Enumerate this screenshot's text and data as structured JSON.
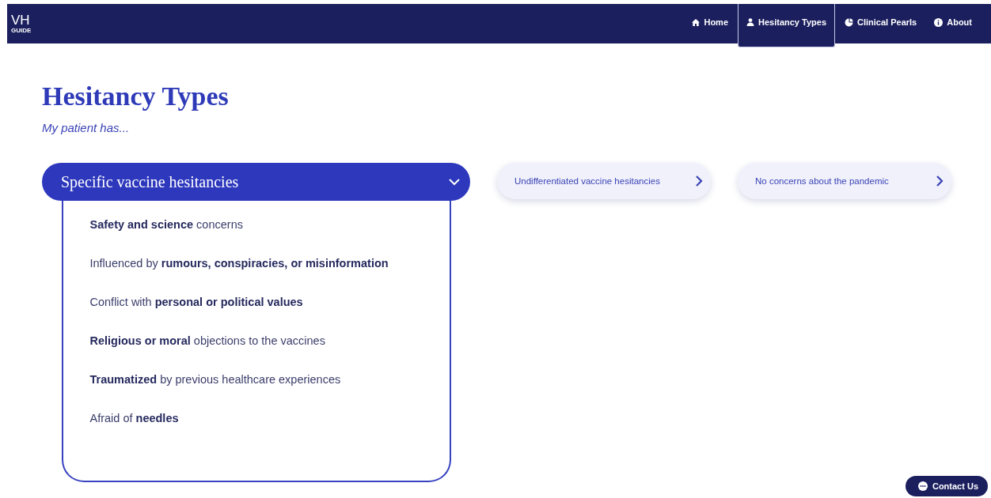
{
  "logo": {
    "title": "VH",
    "subtitle": "GUIDE"
  },
  "nav": [
    {
      "label": "Home",
      "kind": "home",
      "selected": false
    },
    {
      "label": "Hesitancy Types",
      "kind": "user",
      "selected": true
    },
    {
      "label": "Clinical Pearls",
      "kind": "pearl",
      "selected": false
    },
    {
      "label": "About",
      "kind": "info",
      "selected": false
    }
  ],
  "page_title": "Hesitancy Types",
  "subtitle": "My patient has...",
  "categories": [
    {
      "title": "Specific vaccine hesitancies",
      "expanded": true,
      "items": [
        "**Safety and science** concerns",
        "Influenced by **rumours, conspiracies, or misinformation**",
        "Conflict with **personal or political values**",
        "**Religious or moral** objections to the vaccines",
        "**Traumatized** by previous healthcare experiences",
        "Afraid of **needles**"
      ]
    },
    {
      "title": "Undifferentiated vaccine hesitancies",
      "expanded": false
    },
    {
      "title": "No concerns about the pandemic",
      "expanded": false
    }
  ],
  "contact_button": "Contact Us"
}
